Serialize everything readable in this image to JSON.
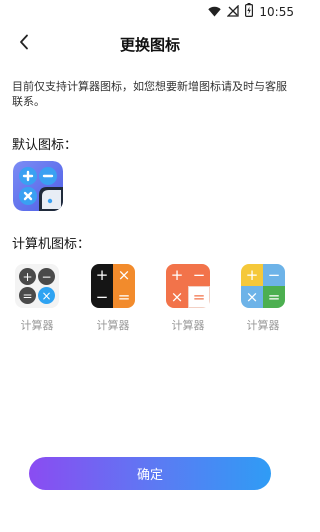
{
  "status": {
    "time": "10:55",
    "icons": [
      "wifi-icon",
      "signal-off-icon",
      "battery-charging-icon"
    ]
  },
  "header": {
    "title": "更换图标",
    "back_icon": "back-arrow-icon"
  },
  "notice": "目前仅支持计算器图标，如您想要新增图标请及时与客服联系。",
  "default_section": {
    "title": "默认图标："
  },
  "calc_section": {
    "title": "计算机图标：",
    "icons": [
      {
        "label": "计算器",
        "style": "circles-white"
      },
      {
        "label": "计算器",
        "style": "black-orange"
      },
      {
        "label": "计算器",
        "style": "orange-white"
      },
      {
        "label": "计算器",
        "style": "multicolor"
      }
    ]
  },
  "confirm_button": {
    "label": "确定"
  },
  "colors": {
    "accent_start": "#8a4cf2",
    "accent_end": "#2f9cf5",
    "orange": "#f28b2c",
    "blue": "#2ea3f2"
  }
}
